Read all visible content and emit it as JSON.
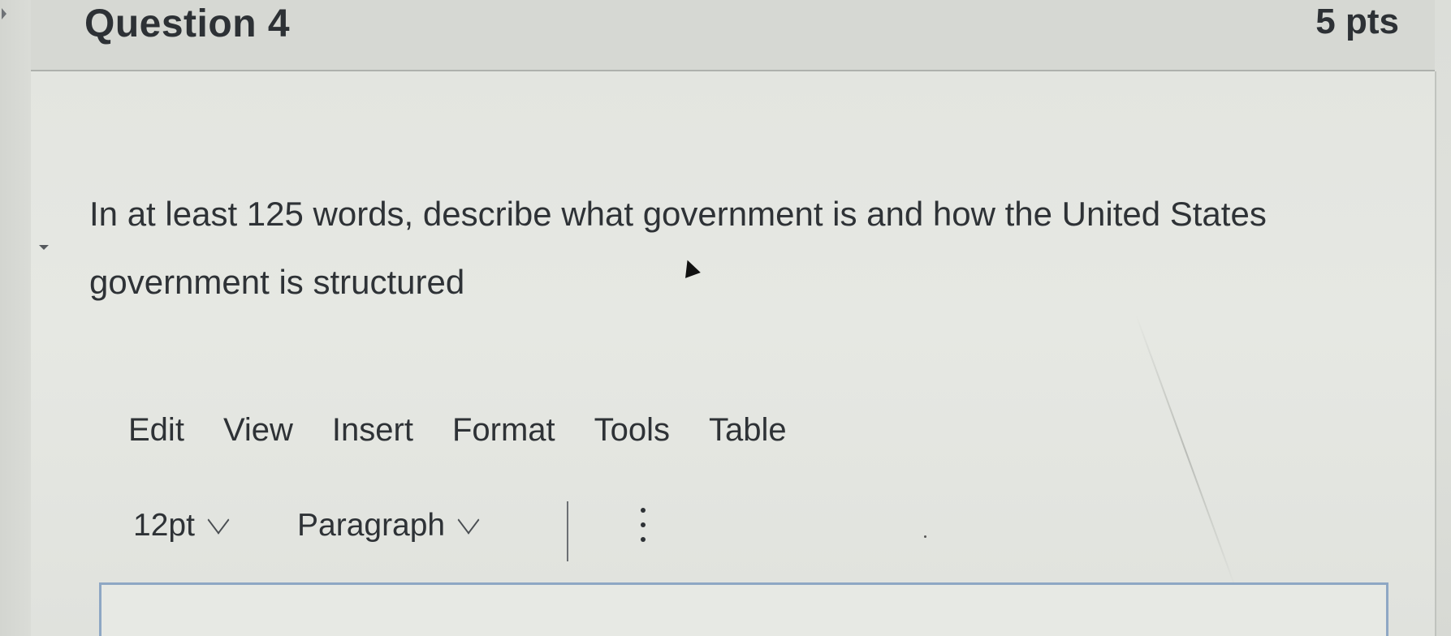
{
  "question": {
    "title": "Question 4",
    "points": "5 pts",
    "prompt": "In at least 125 words, describe what government is and how the United States government is structured"
  },
  "editor": {
    "menu": [
      "Edit",
      "View",
      "Insert",
      "Format",
      "Tools",
      "Table"
    ],
    "toolbar": {
      "font_size": "12pt",
      "block_format": "Paragraph"
    }
  },
  "icons": {
    "more": "vertical-ellipsis-icon",
    "dropdown": "chevron-down-icon",
    "pointer": "mouse-pointer-icon"
  },
  "colors": {
    "editor_border": "#8ea7c4",
    "text": "#2e3236"
  }
}
